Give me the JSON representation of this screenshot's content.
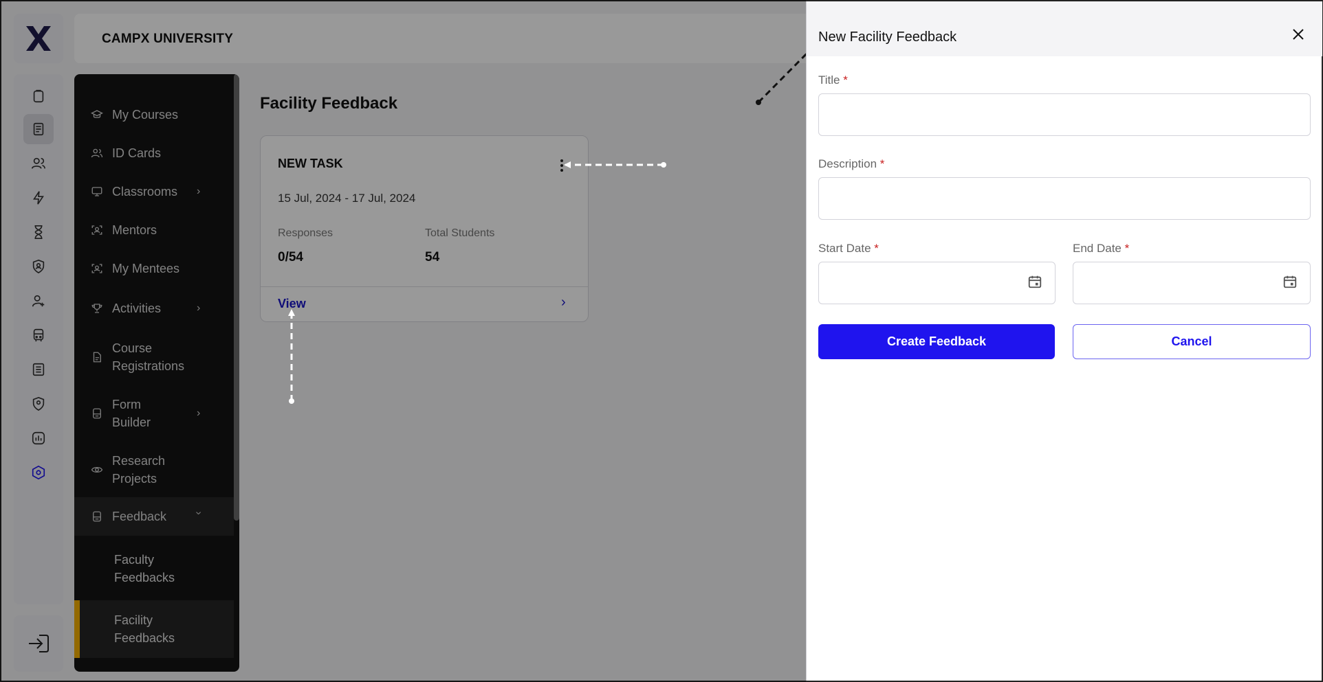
{
  "header": {
    "university_name": "CAMPX UNIVERSITY"
  },
  "rail": {
    "logo": "campx-logo",
    "icons": [
      "clipboard-icon",
      "document-icon",
      "people-icon",
      "lightning-icon",
      "hourglass-icon",
      "shield-user-icon",
      "user-add-icon",
      "bus-icon",
      "list-document-icon",
      "location-shield-icon",
      "chart-icon",
      "settings-hex-icon"
    ],
    "active_icon": "document-icon",
    "logout_icon": "logout-icon"
  },
  "sidebar": {
    "items": [
      {
        "label": "My Courses",
        "icon": "graduation-cap-icon"
      },
      {
        "label": "ID Cards",
        "icon": "users-icon"
      },
      {
        "label": "Classrooms",
        "icon": "monitor-icon",
        "has_chevron": true
      },
      {
        "label": "Mentors",
        "icon": "user-scan-icon"
      },
      {
        "label": "My Mentees",
        "icon": "user-scan-icon"
      },
      {
        "label": "Activities",
        "icon": "trophy-icon",
        "has_chevron": true
      },
      {
        "label": "Course Registrations",
        "icon": "file-icon"
      },
      {
        "label": "Form Builder",
        "icon": "form-icon",
        "has_chevron": true
      },
      {
        "label": "Research Projects",
        "icon": "eye-icon"
      },
      {
        "label": "Feedback",
        "icon": "feedback-icon",
        "has_chevron": true,
        "expanded": true
      }
    ],
    "sub_items": [
      {
        "label": "Faculty Feedbacks"
      },
      {
        "label": "Facility Feedbacks",
        "active": true
      }
    ],
    "labels_multiline": {
      "course_registrations": [
        "Course",
        "Registrations"
      ],
      "form_builder": [
        "Form",
        "Builder"
      ],
      "research_projects": [
        "Research",
        "Projects"
      ],
      "faculty_feedbacks": [
        "Faculty",
        "Feedbacks"
      ],
      "facility_feedbacks": [
        "Facility",
        "Feedbacks"
      ]
    }
  },
  "main": {
    "page_title": "Facility Feedback",
    "card": {
      "title": "NEW TASK",
      "dates": "15 Jul, 2024 - 17 Jul, 2024",
      "responses_label": "Responses",
      "responses_value": "0/54",
      "total_label": "Total Students",
      "total_value": "54",
      "view_label": "View"
    }
  },
  "drawer": {
    "title": "New Facility Feedback",
    "fields": {
      "title_label": "Title",
      "title_value": "",
      "description_label": "Description",
      "description_value": "",
      "start_date_label": "Start Date",
      "start_date_value": "",
      "end_date_label": "End Date",
      "end_date_value": "",
      "required_mark": "*"
    },
    "create_button": "Create Feedback",
    "cancel_button": "Cancel"
  },
  "colors": {
    "primary": "#1f14ee",
    "sidebar_bg": "#141414",
    "active_indicator": "#f5b000",
    "required": "#c82020"
  }
}
